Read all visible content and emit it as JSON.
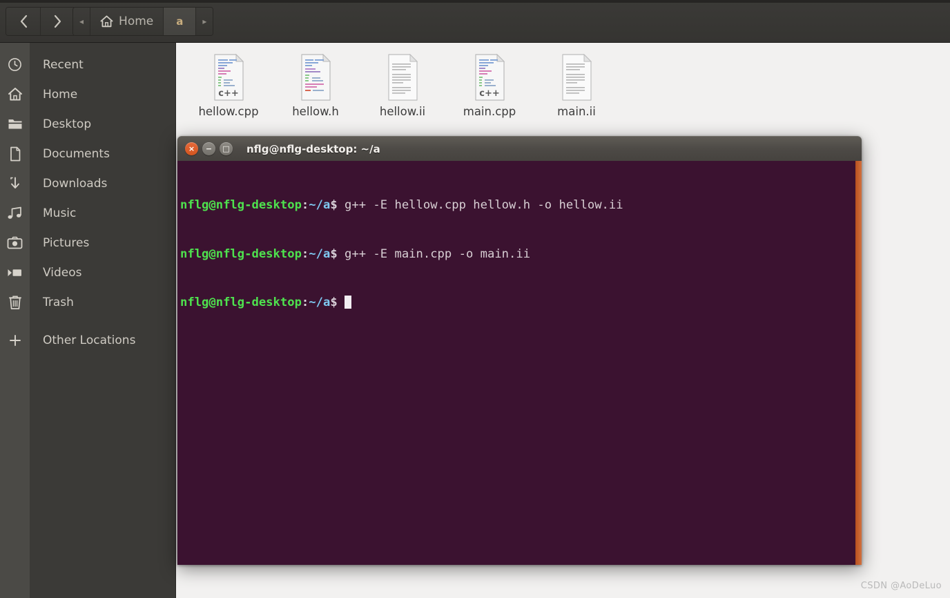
{
  "window": {
    "app": "Files",
    "background_color": "#f2f1f0"
  },
  "header": {
    "back_label": "‹",
    "forward_label": "›",
    "breadcrumbs": [
      {
        "label": "◂",
        "name": "breadcrumb-scroll-left",
        "type": "arrow"
      },
      {
        "label": "Home",
        "name": "breadcrumb-home",
        "type": "crumb",
        "icon": "home-icon"
      },
      {
        "label": "a",
        "name": "breadcrumb-a",
        "type": "crumb",
        "active": true
      },
      {
        "label": "▸",
        "name": "breadcrumb-scroll-right",
        "type": "arrow"
      }
    ]
  },
  "sidebar": {
    "items": [
      {
        "label": "Recent",
        "icon": "clock-icon"
      },
      {
        "label": "Home",
        "icon": "home-icon"
      },
      {
        "label": "Desktop",
        "icon": "folder-icon"
      },
      {
        "label": "Documents",
        "icon": "document-icon"
      },
      {
        "label": "Downloads",
        "icon": "download-icon"
      },
      {
        "label": "Music",
        "icon": "music-note-icon"
      },
      {
        "label": "Pictures",
        "icon": "camera-icon"
      },
      {
        "label": "Videos",
        "icon": "video-icon"
      },
      {
        "label": "Trash",
        "icon": "trash-icon"
      },
      {
        "label": "Other Locations",
        "icon": "plus-icon"
      }
    ]
  },
  "files": [
    {
      "name": "hellow.cpp",
      "kind": "cpp-source",
      "badge": "c++"
    },
    {
      "name": "hellow.h",
      "kind": "c-header",
      "badge": ""
    },
    {
      "name": "hellow.ii",
      "kind": "text",
      "badge": ""
    },
    {
      "name": "main.cpp",
      "kind": "cpp-source",
      "badge": "c++"
    },
    {
      "name": "main.ii",
      "kind": "text",
      "badge": ""
    }
  ],
  "terminal": {
    "title": "nflg@nflg-desktop: ~/a",
    "buttons": {
      "close": "×",
      "minimize": "−",
      "maximize": "□"
    },
    "colors": {
      "background": "#3b1230",
      "prompt_user": "#4ee24e",
      "prompt_path": "#7ec8f0",
      "text": "#d8cfd4",
      "scrollbar": "#c4611e"
    },
    "lines": [
      {
        "user": "nflg@nflg-desktop",
        "colon": ":",
        "path": "~/a",
        "dollar": "$",
        "command": " g++ -E hellow.cpp hellow.h -o hellow.ii"
      },
      {
        "user": "nflg@nflg-desktop",
        "colon": ":",
        "path": "~/a",
        "dollar": "$",
        "command": " g++ -E main.cpp -o main.ii"
      },
      {
        "user": "nflg@nflg-desktop",
        "colon": ":",
        "path": "~/a",
        "dollar": "$",
        "command": " ",
        "cursor": true
      }
    ]
  },
  "watermark": {
    "text": "CSDN @AoDeLuo"
  }
}
